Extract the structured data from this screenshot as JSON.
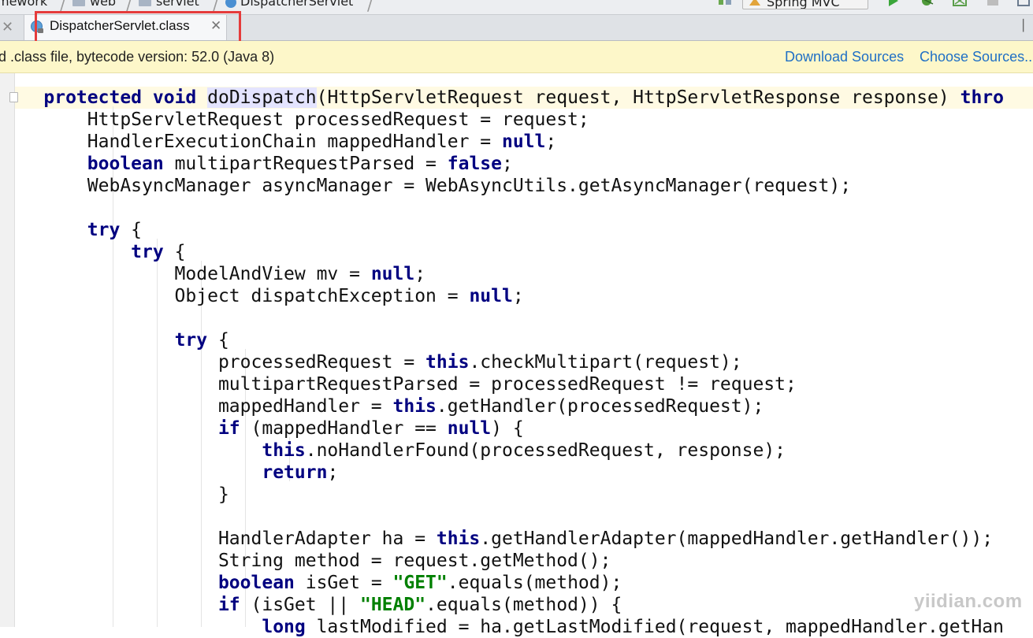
{
  "navbar": {
    "breadcrumbs": [
      "mework",
      "web",
      "servlet",
      "DispatcherServlet"
    ],
    "run_config": "Spring MVC"
  },
  "tabs": [
    {
      "label": "DispatcherServlet.class",
      "active": true
    }
  ],
  "notice": {
    "message": "d .class file, bytecode version: 52.0 (Java 8)",
    "download_sources": "Download Sources",
    "choose_sources": "Choose Sources..."
  },
  "colors": {
    "keyword": "#000080",
    "string": "#008000",
    "highlight_box": "#e53b3b",
    "link": "#1f6fc5",
    "notice_bg": "#fdf7c9"
  },
  "code": {
    "lines": [
      [
        "    ",
        {
          "k": "protected"
        },
        " ",
        {
          "k": "void"
        },
        " ",
        {
          "m": "doDispatch"
        },
        "(HttpServletRequest request, HttpServletResponse response) ",
        {
          "k": "thro"
        }
      ],
      [
        "        HttpServletRequest processedRequest = request;"
      ],
      [
        "        HandlerExecutionChain mappedHandler = ",
        {
          "k": "null"
        },
        ";"
      ],
      [
        "        ",
        {
          "k": "boolean"
        },
        " multipartRequestParsed = ",
        {
          "k": "false"
        },
        ";"
      ],
      [
        "        WebAsyncManager asyncManager = WebAsyncUtils.getAsyncManager(request);"
      ],
      [
        ""
      ],
      [
        "        ",
        {
          "k": "try"
        },
        " {"
      ],
      [
        "            ",
        {
          "k": "try"
        },
        " {"
      ],
      [
        "                ModelAndView mv = ",
        {
          "k": "null"
        },
        ";"
      ],
      [
        "                Object dispatchException = ",
        {
          "k": "null"
        },
        ";"
      ],
      [
        ""
      ],
      [
        "                ",
        {
          "k": "try"
        },
        " {"
      ],
      [
        "                    processedRequest = ",
        {
          "k": "this"
        },
        ".checkMultipart(request);"
      ],
      [
        "                    multipartRequestParsed = processedRequest != request;"
      ],
      [
        "                    mappedHandler = ",
        {
          "k": "this"
        },
        ".getHandler(processedRequest);"
      ],
      [
        "                    ",
        {
          "k": "if"
        },
        " (mappedHandler == ",
        {
          "k": "null"
        },
        ") {"
      ],
      [
        "                        ",
        {
          "k": "this"
        },
        ".noHandlerFound(processedRequest, response);"
      ],
      [
        "                        ",
        {
          "k": "return"
        },
        ";"
      ],
      [
        "                    }"
      ],
      [
        ""
      ],
      [
        "                    HandlerAdapter ha = ",
        {
          "k": "this"
        },
        ".getHandlerAdapter(mappedHandler.getHandler());"
      ],
      [
        "                    String method = request.getMethod();"
      ],
      [
        "                    ",
        {
          "k": "boolean"
        },
        " isGet = ",
        {
          "s": "\"GET\""
        },
        ".equals(method);"
      ],
      [
        "                    ",
        {
          "k": "if"
        },
        " (isGet || ",
        {
          "s": "\"HEAD\""
        },
        ".equals(method)) {"
      ],
      [
        "                        ",
        {
          "k": "long"
        },
        " lastModified = ha.getLastModified(request, mappedHandler.getHan"
      ]
    ]
  },
  "watermark": "yiidian.com"
}
